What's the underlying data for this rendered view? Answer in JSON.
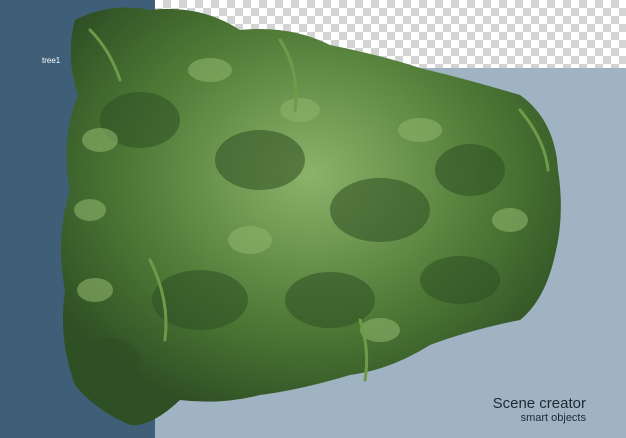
{
  "scene": {
    "object_label": "tree1",
    "brand_title": "Scene creator",
    "brand_subtitle": "smart objects"
  },
  "colors": {
    "left_panel": "#3f5f78",
    "right_panel": "#9fb3c3",
    "foliage_dark": "#2f4f24",
    "foliage_mid": "#4e7a36",
    "foliage_light": "#8db36a"
  }
}
